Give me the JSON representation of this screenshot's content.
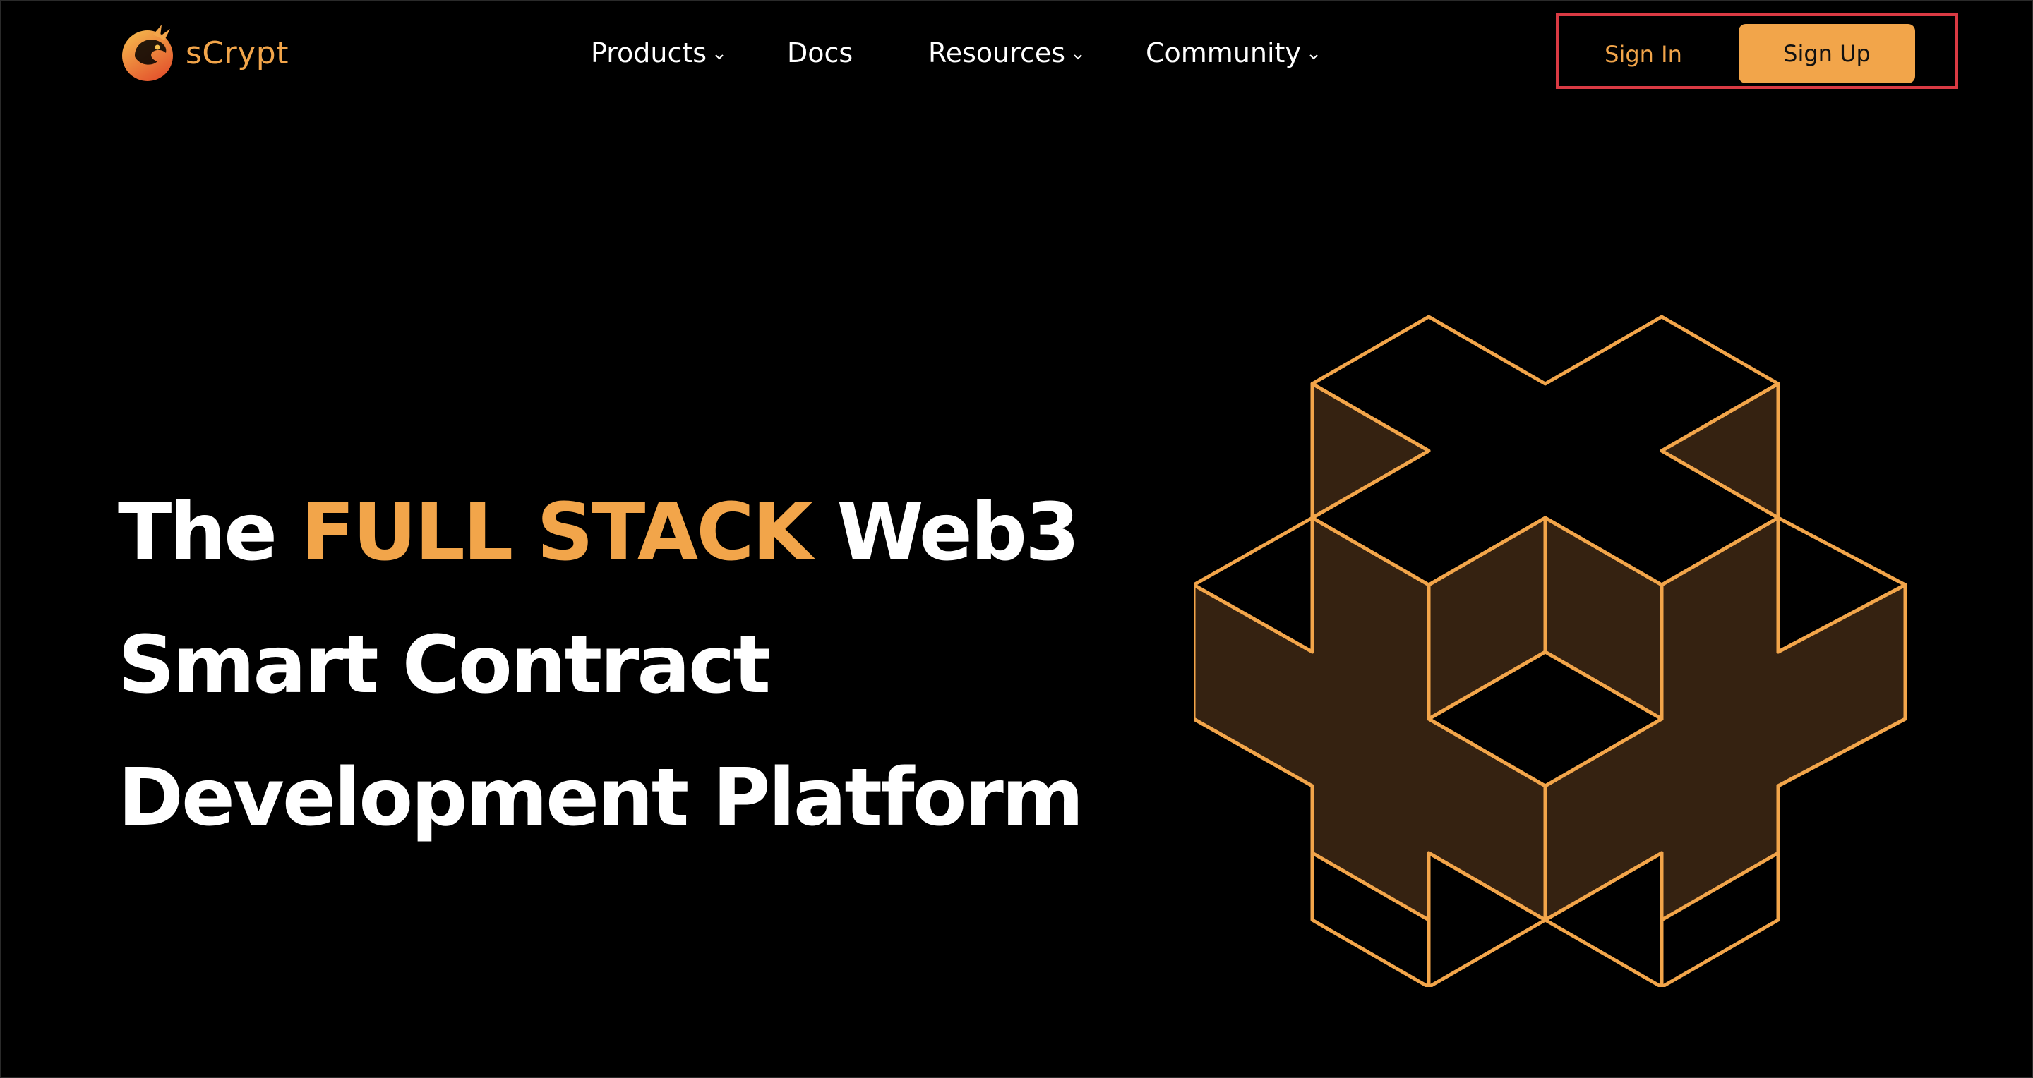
{
  "header": {
    "logo_text": "sCrypt",
    "nav": [
      {
        "label": "Products",
        "has_dropdown": true
      },
      {
        "label": "Docs",
        "has_dropdown": false
      },
      {
        "label": "Resources",
        "has_dropdown": true
      },
      {
        "label": "Community",
        "has_dropdown": true
      }
    ],
    "auth": {
      "signin_label": "Sign In",
      "signup_label": "Sign Up"
    }
  },
  "hero": {
    "title_prefix": "The ",
    "title_accent": "FULL STACK",
    "title_suffix": " Web3",
    "title_line2": "Smart Contract",
    "title_line3": "Development Platform"
  },
  "colors": {
    "accent": "#f2a54a",
    "background": "#000000",
    "graphic_fill": "#352211",
    "highlight_box": "#d93a43"
  },
  "icons": [
    "scrypt-dragon-logo-icon",
    "chevron-down-icon",
    "isometric-cross-block-graphic"
  ]
}
